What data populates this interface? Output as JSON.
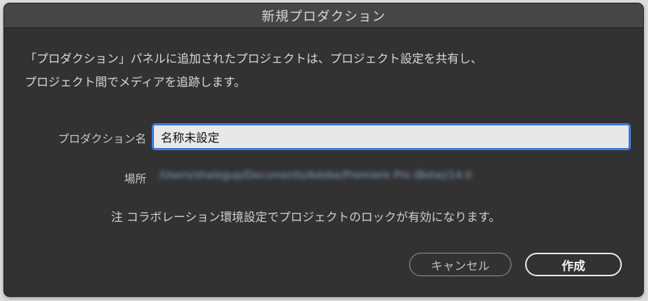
{
  "dialog": {
    "title": "新規プロダクション",
    "description_line1": "「プロダクション」パネルに追加されたプロジェクトは、プロジェクト設定を共有し、",
    "description_line2": "プロジェクト間でメディアを追跡します。",
    "name_label": "プロダクション名",
    "name_value": "名称未設定",
    "location_label": "場所",
    "location_value": "/Users/shalegup/Documents/Adobe/Premiere Pro (Beta)/14.0",
    "note": "注 コラボレーション環境設定でプロジェクトのロックが有効になります。",
    "cancel_label": "キャンセル",
    "create_label": "作成"
  },
  "colors": {
    "dialog_bg": "#323232",
    "titlebar_bg": "#464646",
    "input_focus": "#2e72d8"
  }
}
